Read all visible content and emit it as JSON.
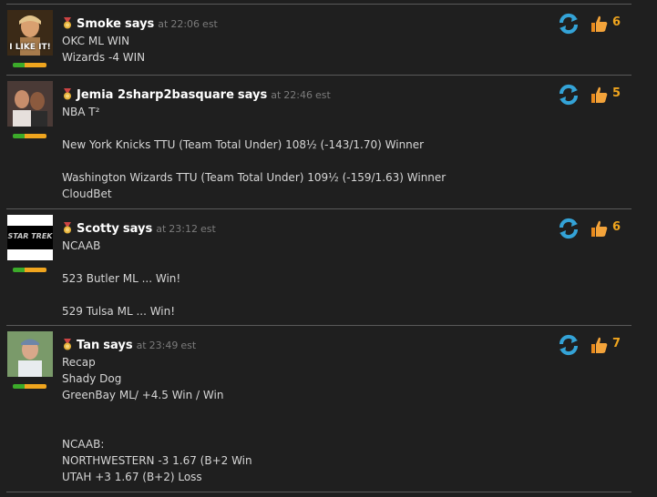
{
  "posts": [
    {
      "name": "Smoke",
      "says": "says",
      "at": "at",
      "time": "22:06",
      "tz": "est",
      "likes": "6",
      "avatar_text": "I LIKE IT!",
      "lines": [
        "OKC ML WIN",
        "Wizards -4 WIN"
      ]
    },
    {
      "name": "Jemia 2sharp2basquare",
      "says": "says",
      "at": "at",
      "time": "22:46",
      "tz": "est",
      "likes": "5",
      "lines": [
        "NBA T²",
        "",
        "New York Knicks TTU (Team Total Under) 108½ (-143/1.70) Winner",
        "",
        "Washington Wizards TTU (Team Total Under) 109½ (-159/1.63) Winner",
        "CloudBet"
      ]
    },
    {
      "name": "Scotty",
      "says": "says",
      "at": "at",
      "time": "23:12",
      "tz": "est",
      "likes": "6",
      "avatar_text": "STAR TREK",
      "lines": [
        "NCAAB",
        "",
        "523 Butler ML ... Win!",
        "",
        "529 Tulsa ML ... Win!"
      ]
    },
    {
      "name": "Tan",
      "says": "says",
      "at": "at",
      "time": "23:49",
      "tz": "est",
      "likes": "7",
      "lines": [
        "Recap",
        "Shady Dog",
        "GreenBay ML/ +4.5 Win / Win",
        "",
        "",
        "NCAAB:",
        "NORTHWESTERN -3 1.67 (B+2 Win",
        "UTAH +3 1.67 (B+2) Loss"
      ]
    }
  ],
  "colors": {
    "count": "#f0a51e",
    "name": "#ffffff",
    "meta": "#7b7b7b",
    "text": "#d6d6d6"
  },
  "icons": [
    "medal-icon",
    "refresh-icon",
    "thumbs-up-icon"
  ]
}
